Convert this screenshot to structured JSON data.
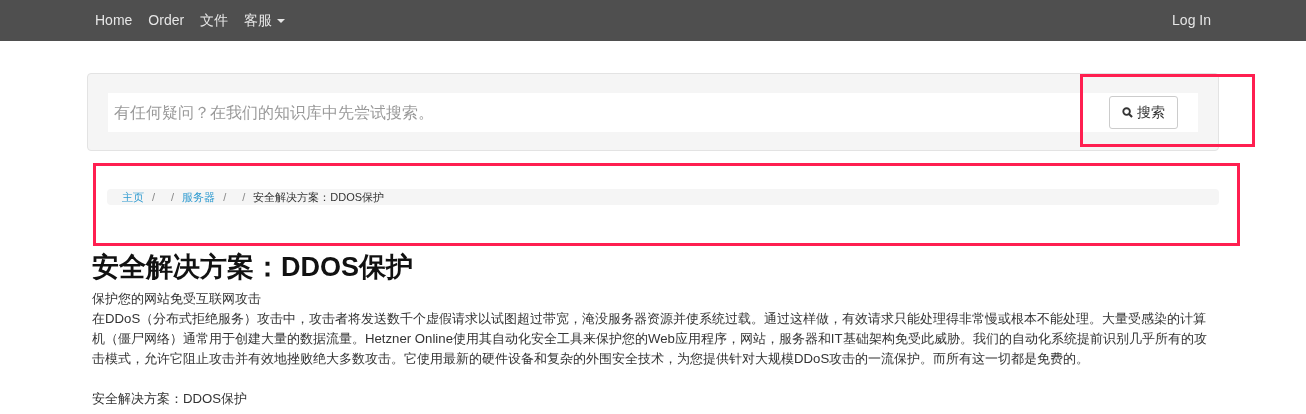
{
  "navbar": {
    "items": [
      {
        "label": "Home",
        "kind": "link"
      },
      {
        "label": "Order",
        "kind": "link"
      },
      {
        "label": "文件",
        "kind": "link"
      },
      {
        "label": "客服",
        "kind": "dropdown"
      }
    ],
    "right": "Log In"
  },
  "search": {
    "placeholder": "有任何疑问？在我们的知识库中先尝试搜索。",
    "button": "搜索"
  },
  "breadcrumb": [
    {
      "label": "主页",
      "kind": "link"
    },
    {
      "label": "/",
      "kind": "separator"
    },
    {
      "label": "/",
      "kind": "separator"
    },
    {
      "label": "服务器",
      "kind": "link"
    },
    {
      "label": "/",
      "kind": "separator"
    },
    {
      "label": "/",
      "kind": "separator"
    },
    {
      "label": "安全解决方案：DDOS保护",
      "kind": "current"
    }
  ],
  "title": "安全解决方案：DDOS保护",
  "paragraphs": [
    "保护您的网站免受互联网攻击",
    "在DDoS（分布式拒绝服务）攻击中，攻击者将发送数千个虚假请求以试图超过带宽，淹没服务器资源并使系统过载。通过这样做，有效请求只能处理得非常慢或根本不能处理。大量受感染的计算机（僵尸网络）通常用于创建大量的数据流量。Hetzner Online使用其自动化安全工具来保护您的Web应用程序，网站，服务器和IT基础架构免受此威胁。我们的自动化系统提前识别几乎所有的攻击模式，允许它阻止攻击并有效地挫败绝大多数攻击。它使用最新的硬件设备和复杂的外围安全技术，为您提供针对大规模DDoS攻击的一流保护。而所有这一切都是免费的。",
    "安全解决方案：DDOS保护"
  ]
}
